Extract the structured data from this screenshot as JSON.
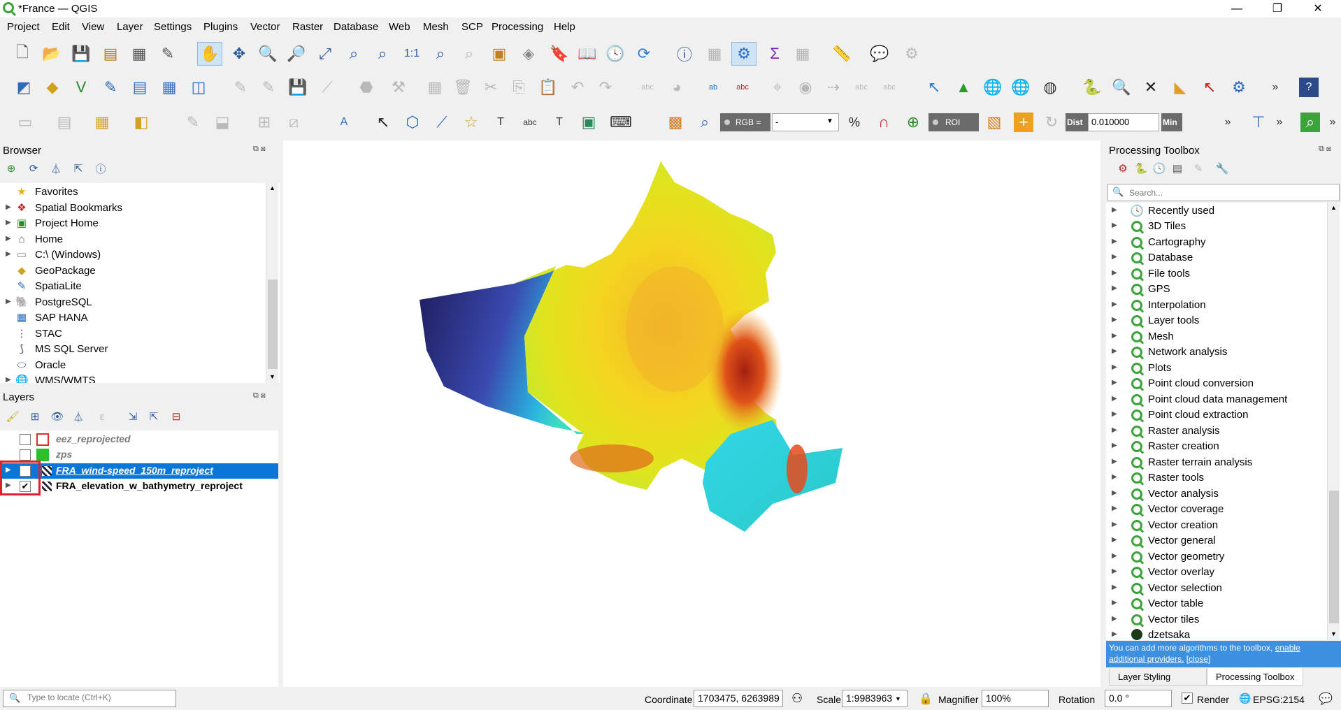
{
  "window": {
    "title": "*France — QGIS",
    "minimize": "—",
    "restore": "❐",
    "close": "✕"
  },
  "menu": [
    "Project",
    "Edit",
    "View",
    "Layer",
    "Settings",
    "Plugins",
    "Vector",
    "Raster",
    "Database",
    "Web",
    "Mesh",
    "SCP",
    "Processing",
    "Help"
  ],
  "toolbar3": {
    "rgb_label": "RGB =",
    "rgb_value": "-",
    "roi_label": "ROI",
    "dist_label": "Dist",
    "dist_value": "0.010000",
    "min_label": "Min"
  },
  "browser": {
    "title": "Browser",
    "items": [
      {
        "label": "Favorites",
        "icon": "star-icon",
        "expandable": false
      },
      {
        "label": "Spatial Bookmarks",
        "icon": "bookmark-icon",
        "expandable": true
      },
      {
        "label": "Project Home",
        "icon": "project-home-icon",
        "expandable": true
      },
      {
        "label": "Home",
        "icon": "home-folder-icon",
        "expandable": true
      },
      {
        "label": "C:\\ (Windows)",
        "icon": "drive-icon",
        "expandable": true
      },
      {
        "label": "GeoPackage",
        "icon": "geopackage-icon",
        "expandable": false
      },
      {
        "label": "SpatiaLite",
        "icon": "spatialite-icon",
        "expandable": false
      },
      {
        "label": "PostgreSQL",
        "icon": "postgresql-icon",
        "expandable": true
      },
      {
        "label": "SAP HANA",
        "icon": "sap-hana-icon",
        "expandable": false
      },
      {
        "label": "STAC",
        "icon": "stac-icon",
        "expandable": false
      },
      {
        "label": "MS SQL Server",
        "icon": "mssql-icon",
        "expandable": false
      },
      {
        "label": "Oracle",
        "icon": "oracle-icon",
        "expandable": false
      },
      {
        "label": "WMS/WMTS",
        "icon": "wms-icon",
        "expandable": true
      }
    ]
  },
  "layers": {
    "title": "Layers",
    "items": [
      {
        "name": "eez_reprojected",
        "checked": false,
        "selected": false,
        "italic": true,
        "swatch": "#ffffff",
        "swatch_border": "#d9302b"
      },
      {
        "name": "zps",
        "checked": false,
        "selected": false,
        "italic": true,
        "swatch": "#2bc02b",
        "swatch_border": "#2bc02b"
      },
      {
        "name": "FRA_wind-speed_150m_reproject",
        "checked": false,
        "selected": true,
        "italic": true,
        "swatch": "raster",
        "swatch_border": ""
      },
      {
        "name": "FRA_elevation_w_bathymetry_reproject",
        "checked": true,
        "selected": false,
        "italic": false,
        "swatch": "raster",
        "swatch_border": ""
      }
    ],
    "highlight_color": "#e0202a",
    "selected_bg": "#0a77d8"
  },
  "processing": {
    "title": "Processing Toolbox",
    "search_placeholder": "Search...",
    "items": [
      "Recently used",
      "3D Tiles",
      "Cartography",
      "Database",
      "File tools",
      "GPS",
      "Interpolation",
      "Layer tools",
      "Mesh",
      "Network analysis",
      "Plots",
      "Point cloud conversion",
      "Point cloud data management",
      "Point cloud extraction",
      "Raster analysis",
      "Raster creation",
      "Raster terrain analysis",
      "Raster tools",
      "Vector analysis",
      "Vector coverage",
      "Vector creation",
      "Vector general",
      "Vector geometry",
      "Vector overlay",
      "Vector selection",
      "Vector table",
      "Vector tiles",
      "dzetsaka"
    ],
    "info_text": "You can add more algorithms to the toolbox, ",
    "info_link": "enable additional providers.",
    "info_close": "[close]",
    "tabs": [
      "Layer Styling",
      "Processing Toolbox"
    ]
  },
  "statusbar": {
    "locate_placeholder": "Type to locate (Ctrl+K)",
    "coordinate_label": "Coordinate",
    "coordinate_value": "1703475, 6263989",
    "scale_label": "Scale",
    "scale_value": "1:9983963",
    "magnifier_label": "Magnifier",
    "magnifier_value": "100%",
    "rotation_label": "Rotation",
    "rotation_value": "0.0 °",
    "render_label": "Render",
    "render_checked": true,
    "crs": "EPSG:2154"
  }
}
